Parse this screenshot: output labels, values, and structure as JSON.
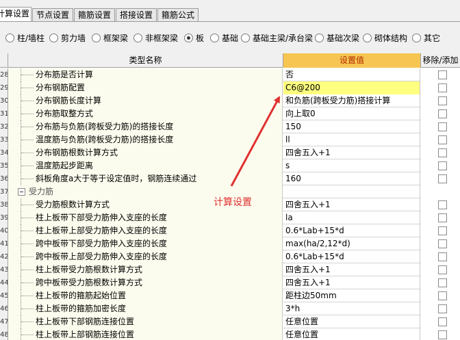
{
  "tabs": [
    "计算设置",
    "节点设置",
    "箍筋设置",
    "搭接设置",
    "箍筋公式"
  ],
  "component_types": [
    {
      "label": "柱/墙柱",
      "selected": false
    },
    {
      "label": "剪力墙",
      "selected": false
    },
    {
      "label": "框架梁",
      "selected": false
    },
    {
      "label": "非框架梁",
      "selected": false
    },
    {
      "label": "板",
      "selected": true
    },
    {
      "label": "基础",
      "selected": false
    },
    {
      "label": "基础主梁/承台梁",
      "selected": false
    },
    {
      "label": "基础次梁",
      "selected": false
    },
    {
      "label": "砌体结构",
      "selected": false
    },
    {
      "label": "其它",
      "selected": false
    }
  ],
  "columns": {
    "name": "类型名称",
    "value": "设置值",
    "action": "移除/添加"
  },
  "rows": [
    {
      "num": "28",
      "name": "分布筋是否计算",
      "value": "否"
    },
    {
      "num": "29",
      "name": "分布钢筋配置",
      "value": "C6@200",
      "selected": true
    },
    {
      "num": "30",
      "name": "分布钢筋长度计算",
      "value": "和负筋(跨板受力筋)搭接计算"
    },
    {
      "num": "31",
      "name": "分布筋取整方式",
      "value": "向上取0"
    },
    {
      "num": "32",
      "name": "分布筋与负筋(跨板受力筋)的搭接长度",
      "value": "150"
    },
    {
      "num": "33",
      "name": "温度筋与负筋(跨板受力筋)的搭接长度",
      "value": "ll"
    },
    {
      "num": "34",
      "name": "分布钢筋根数计算方式",
      "value": "四舍五入+1"
    },
    {
      "num": "35",
      "name": "温度筋起步距离",
      "value": "s"
    },
    {
      "num": "36",
      "name": "斜板角度a大于等于设定值时，钢筋连续通过",
      "value": "160"
    },
    {
      "num": "37",
      "group": "受力筋"
    },
    {
      "num": "38",
      "name": "受力筋根数计算方式",
      "value": "四舍五入+1"
    },
    {
      "num": "39",
      "name": "柱上板带下部受力筋伸入支座的长度",
      "value": "la"
    },
    {
      "num": "40",
      "name": "柱上板带上部受力筋伸入支座的长度",
      "value": "0.6*Lab+15*d"
    },
    {
      "num": "41",
      "name": "跨中板带下部受力筋伸入支座的长度",
      "value": "max(ha/2,12*d)"
    },
    {
      "num": "42",
      "name": "跨中板带上部受力筋伸入支座的长度",
      "value": "0.6*Lab+15*d"
    },
    {
      "num": "43",
      "name": "柱上板带受力筋根数计算方式",
      "value": "四舍五入+1"
    },
    {
      "num": "44",
      "name": "跨中板带受力筋根数计算方式",
      "value": "四舍五入+1"
    },
    {
      "num": "45",
      "name": "柱上板带的箍筋起始位置",
      "value": "距柱边50mm"
    },
    {
      "num": "46",
      "name": "柱上板带的箍筋加密长度",
      "value": "3*h"
    },
    {
      "num": "47",
      "name": "柱上板带下部钢筋连接位置",
      "value": "任意位置"
    },
    {
      "num": "48",
      "name": "柱上板带上部钢筋连接位置",
      "value": "任意位置"
    }
  ],
  "annotation": "计算设置",
  "colors": {
    "header_highlight": "#f6c552",
    "selected_value": "#ffff80",
    "annotation": "#e03030"
  }
}
